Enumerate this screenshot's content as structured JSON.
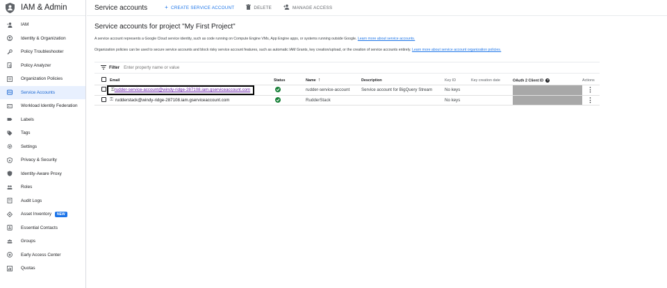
{
  "app": {
    "title": "IAM & Admin"
  },
  "sidebar": {
    "items": [
      {
        "label": "IAM",
        "icon": "person-add-icon",
        "active": false
      },
      {
        "label": "Identity & Organization",
        "icon": "account-circle-icon",
        "active": false
      },
      {
        "label": "Policy Troubleshooter",
        "icon": "wrench-icon",
        "active": false
      },
      {
        "label": "Policy Analyzer",
        "icon": "document-search-icon",
        "active": false
      },
      {
        "label": "Organization Policies",
        "icon": "list-box-icon",
        "active": false
      },
      {
        "label": "Service Accounts",
        "icon": "service-account-icon",
        "active": true
      },
      {
        "label": "Workload Identity Federation",
        "icon": "id-card-icon",
        "active": false
      },
      {
        "label": "Labels",
        "icon": "label-icon",
        "active": false
      },
      {
        "label": "Tags",
        "icon": "tag-icon",
        "active": false
      },
      {
        "label": "Settings",
        "icon": "gear-icon",
        "active": false
      },
      {
        "label": "Privacy & Security",
        "icon": "shield-lock-icon",
        "active": false
      },
      {
        "label": "Identity-Aware Proxy",
        "icon": "proxy-shield-icon",
        "active": false
      },
      {
        "label": "Roles",
        "icon": "roles-icon",
        "active": false
      },
      {
        "label": "Audit Logs",
        "icon": "list-icon",
        "active": false
      },
      {
        "label": "Asset Inventory",
        "icon": "diamond-icon",
        "active": false,
        "badge": "NEW"
      },
      {
        "label": "Essential Contacts",
        "icon": "contacts-icon",
        "active": false
      },
      {
        "label": "Groups",
        "icon": "groups-icon",
        "active": false
      },
      {
        "label": "Early Access Center",
        "icon": "star-badge-icon",
        "active": false
      },
      {
        "label": "Quotas",
        "icon": "quota-icon",
        "active": false
      }
    ]
  },
  "topbar": {
    "page_title": "Service accounts",
    "create_label": "CREATE SERVICE ACCOUNT",
    "delete_label": "DELETE",
    "manage_label": "MANAGE ACCESS"
  },
  "main": {
    "heading": "Service accounts for project \"My First Project\"",
    "desc1_text": "A service account represents a Google Cloud service identity, such as code running on Compute Engine VMs, App Engine apps, or systems running outside Google.",
    "desc1_link": "Learn more about service accounts.",
    "desc2_text": "Organization policies can be used to secure service accounts and block risky service account features, such as automatic IAM Grants, key creation/upload, or the creation of service accounts entirely.",
    "desc2_link": "Learn more about service account organization policies.",
    "filter_label": "Filter",
    "filter_placeholder": "Enter property name or value"
  },
  "table": {
    "columns": {
      "email": "Email",
      "status": "Status",
      "name": "Name",
      "description": "Description",
      "key_id": "Key ID",
      "key_creation": "Key creation date",
      "oauth": "OAuth 2 Client ID",
      "actions": "Actions"
    },
    "rows": [
      {
        "email": "rudder-service-account@windy-ridge-287108.iam.gserviceaccount.com",
        "name": "rudder-service-account",
        "description": "Service account for BigQuery Stream",
        "key_id": "No keys"
      },
      {
        "email": "rudderstack@windy-ridge-287108.iam.gserviceaccount.com",
        "name": "RudderStack",
        "description": "",
        "key_id": "No keys"
      }
    ]
  }
}
